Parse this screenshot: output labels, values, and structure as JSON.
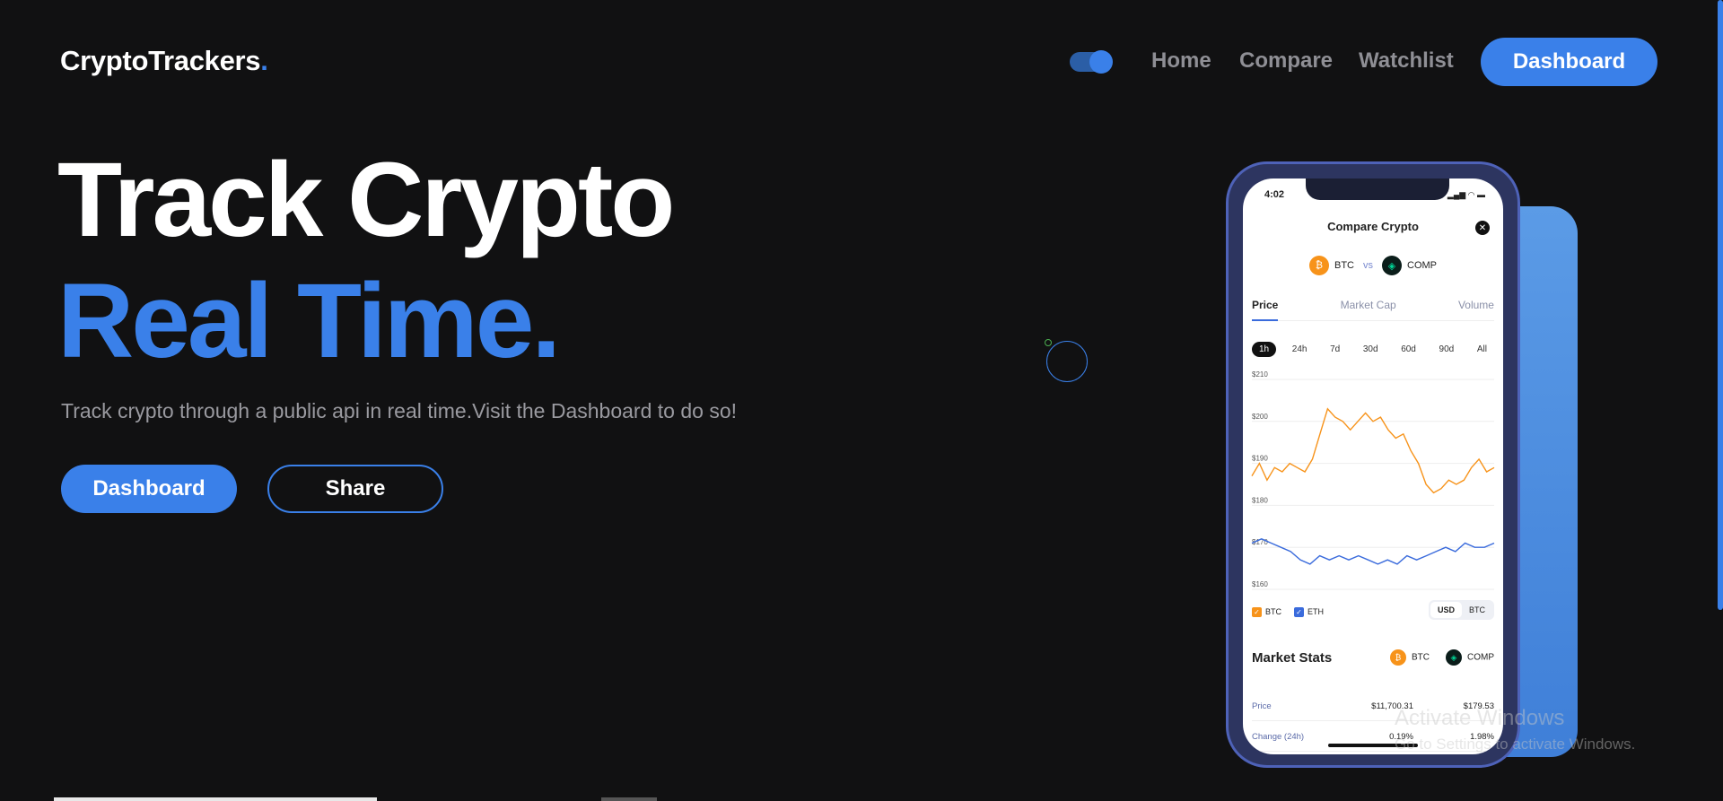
{
  "nav": {
    "logo": "CryptoTrackers",
    "logo_dot": ".",
    "links": [
      "Home",
      "Compare",
      "Watchlist"
    ],
    "cta": "Dashboard",
    "theme_toggle_on": true
  },
  "hero": {
    "line1": "Track Crypto",
    "line2": "Real Time.",
    "subtitle": "Track crypto through a public api in real time.Visit the Dashboard to do so!",
    "primary_button": "Dashboard",
    "secondary_button": "Share"
  },
  "phone": {
    "time": "4:02",
    "title": "Compare Crypto",
    "close": "✕",
    "coin1": "BTC",
    "vs": "vs",
    "coin2": "COMP",
    "tabs": [
      "Price",
      "Market Cap",
      "Volume"
    ],
    "ranges": [
      "1h",
      "24h",
      "7d",
      "30d",
      "60d",
      "90d",
      "All"
    ],
    "legend": [
      "BTC",
      "ETH"
    ],
    "currency": [
      "USD",
      "BTC"
    ],
    "stats_title": "Market Stats",
    "stats": [
      {
        "label": "Price",
        "v1": "$11,700.31",
        "v2": "$179.53"
      },
      {
        "label": "Change (24h)",
        "v1": "0.19%",
        "v2": "1.98%"
      }
    ]
  },
  "chart_data": {
    "type": "line",
    "yticks": [
      "$210",
      "$200",
      "$190",
      "$180",
      "$170",
      "$160"
    ],
    "ylim": [
      160,
      210
    ],
    "series": [
      {
        "name": "BTC",
        "color": "#f7931a",
        "values": [
          187,
          190,
          186,
          189,
          188,
          190,
          189,
          188,
          191,
          197,
          203,
          201,
          200,
          198,
          200,
          202,
          200,
          201,
          198,
          196,
          197,
          193,
          190,
          185,
          183,
          184,
          186,
          185,
          186,
          189,
          191,
          188,
          189
        ]
      },
      {
        "name": "ETH",
        "color": "#3a6bdc",
        "values": [
          171,
          172,
          171,
          170,
          169,
          167,
          166,
          168,
          167,
          168,
          167,
          168,
          167,
          166,
          167,
          166,
          168,
          167,
          168,
          169,
          170,
          169,
          171,
          170,
          170,
          171
        ]
      }
    ]
  },
  "watermark": {
    "title": "Activate Windows",
    "subtitle": "Go to Settings to activate Windows."
  }
}
